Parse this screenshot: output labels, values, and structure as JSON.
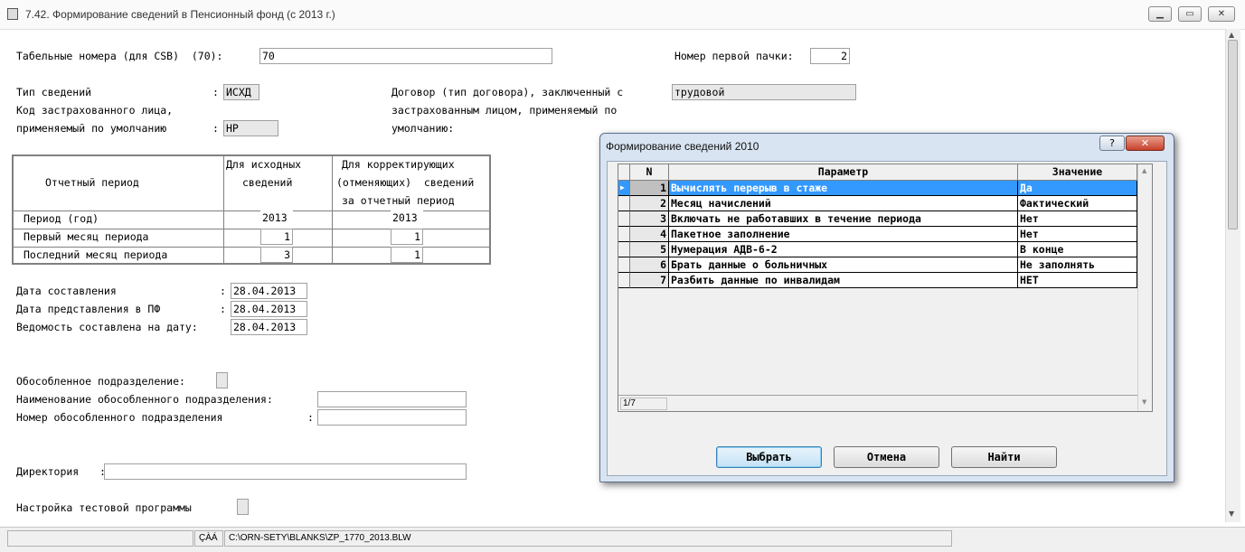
{
  "window": {
    "title": "7.42. Формирование сведений в Пенсионный фонд (с 2013 г.)",
    "buttons": [
      "minimize",
      "maximize",
      "close"
    ]
  },
  "form": {
    "tab_numbers_label": "Табельные номера (для CSB)  (70):",
    "tab_numbers_value": "70",
    "first_pack_label": "Номер первой пачки:",
    "first_pack_value": "2",
    "info_type_label": "Тип сведений",
    "info_type_value": "ИСХД",
    "insured_code_label_1": "Код застрахованного лица,",
    "insured_code_label_2": "применяемый по умолчанию",
    "insured_code_value": "НР",
    "contract_label_1": "Договор (тип договора), заключенный с",
    "contract_label_2": "застрахованным лицом, применяемый по",
    "contract_label_3": "умолчанию:",
    "contract_value": "трудовой",
    "period_table": {
      "h_period": "Отчетный период",
      "h_initial_1": "Для исходных",
      "h_initial_2": "сведений",
      "h_corr_1": "Для корректирующих",
      "h_corr_2": "(отменяющих)  сведений",
      "h_corr_3": "за отчетный период",
      "rows": [
        {
          "label": "Период (год)",
          "initial": "2013",
          "corr": "2013"
        },
        {
          "label": "Первый месяц периода",
          "initial": "1",
          "corr": "1"
        },
        {
          "label": "Последний месяц периода",
          "initial": "3",
          "corr": "1"
        }
      ]
    },
    "date_compiled_label": "Дата составления",
    "date_compiled_value": "28.04.2013",
    "date_submitted_label": "Дата представления в ПФ",
    "date_submitted_value": "28.04.2013",
    "statement_date_label": "Ведомость составлена на дату:",
    "statement_date_value": "28.04.2013",
    "separate_unit_label": "Обособленное подразделение:",
    "separate_unit_name_label": "Наименование обособленного подразделения:",
    "separate_unit_name_value": "",
    "separate_unit_number_label": "Номер обособленного подразделения",
    "separate_unit_number_value": "",
    "directory_label": "Директория",
    "directory_value": "",
    "test_setup_label": "Настройка тестовой программы"
  },
  "status": {
    "code": "ÇÀÁ",
    "path": "C:\\ORN-SETY\\BLANKS\\ZP_1770_2013.BLW"
  },
  "dialog": {
    "title": "Формирование сведений 2010",
    "help": "?",
    "close": "✕",
    "columns": [
      "N",
      "Параметр",
      "Значение"
    ],
    "rows": [
      {
        "n": "1",
        "param": "Вычислять перерыв в стаже",
        "value": "Да"
      },
      {
        "n": "2",
        "param": "Месяц начислений",
        "value": "Фактический"
      },
      {
        "n": "3",
        "param": "Включать не работавших в течение периода",
        "value": "Нет"
      },
      {
        "n": "4",
        "param": "Пакетное заполнение",
        "value": "Нет"
      },
      {
        "n": "5",
        "param": "Нумерация АДВ-6-2",
        "value": "В конце"
      },
      {
        "n": "6",
        "param": "Брать данные о больничных",
        "value": "Не заполнять"
      },
      {
        "n": "7",
        "param": "Разбить данные по инвалидам",
        "value": "НЕТ"
      }
    ],
    "selected_row": 1,
    "record_counter": "1/7",
    "btn_select": "Выбрать",
    "btn_cancel": "Отмена",
    "btn_find": "Найти"
  }
}
